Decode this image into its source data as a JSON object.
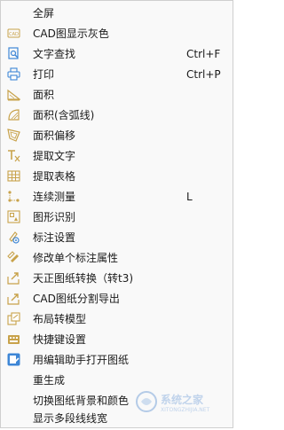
{
  "menu": {
    "items": [
      {
        "label": "全屏",
        "shortcut": "",
        "icon": "none"
      },
      {
        "label": "CAD图显示灰色",
        "shortcut": "",
        "icon": "cad-gray-icon"
      },
      {
        "label": "文字查找",
        "shortcut": "Ctrl+F",
        "icon": "text-search-icon"
      },
      {
        "label": "打印",
        "shortcut": "Ctrl+P",
        "icon": "printer-icon"
      },
      {
        "label": "面积",
        "shortcut": "",
        "icon": "area-icon"
      },
      {
        "label": "面积(含弧线)",
        "shortcut": "",
        "icon": "area-arc-icon"
      },
      {
        "label": "面积偏移",
        "shortcut": "",
        "icon": "area-offset-icon"
      },
      {
        "label": "提取文字",
        "shortcut": "",
        "icon": "extract-text-icon"
      },
      {
        "label": "提取表格",
        "shortcut": "",
        "icon": "extract-table-icon"
      },
      {
        "label": "连续测量",
        "shortcut": "L",
        "icon": "continuous-measure-icon"
      },
      {
        "label": "图形识别",
        "shortcut": "",
        "icon": "shape-recognition-icon"
      },
      {
        "label": "标注设置",
        "shortcut": "",
        "icon": "annotation-settings-icon"
      },
      {
        "label": "修改单个标注属性",
        "shortcut": "",
        "icon": "edit-annotation-icon"
      },
      {
        "label": "天正图纸转换（转t3)",
        "shortcut": "",
        "icon": "tangent-convert-icon"
      },
      {
        "label": "CAD图纸分割导出",
        "shortcut": "",
        "icon": "split-export-icon"
      },
      {
        "label": "布局转模型",
        "shortcut": "",
        "icon": "layout-to-model-icon"
      },
      {
        "label": "快捷键设置",
        "shortcut": "",
        "icon": "keyboard-icon"
      },
      {
        "label": "用编辑助手打开图纸",
        "shortcut": "",
        "icon": "edit-assistant-icon"
      },
      {
        "label": "重生成",
        "shortcut": "",
        "icon": "none"
      },
      {
        "label": "切换图纸背景和颜色",
        "shortcut": "",
        "icon": "none"
      },
      {
        "label": "显示多段线线宽",
        "shortcut": "",
        "icon": "none"
      }
    ]
  },
  "colors": {
    "icon_gold": "#c8a24a",
    "icon_blue": "#3d86d6",
    "menu_bg": "#f9f9f9"
  }
}
